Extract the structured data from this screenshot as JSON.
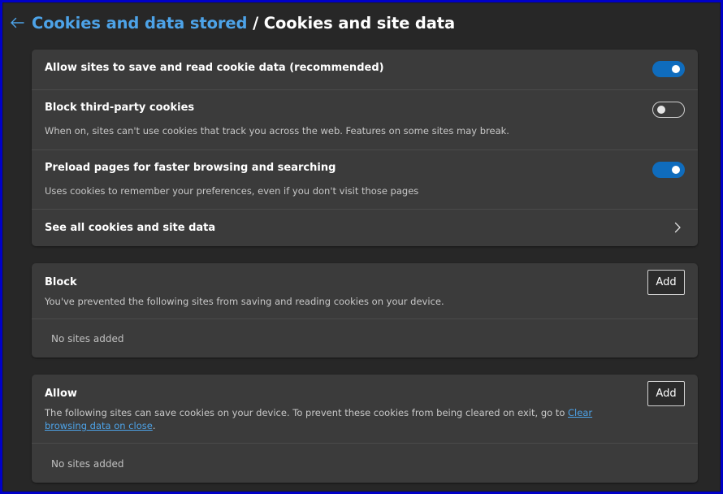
{
  "header": {
    "back_icon": "arrow-left-icon",
    "parent_crumb": "Cookies and data stored",
    "separator": " / ",
    "current": "Cookies and site data"
  },
  "settings": {
    "allow_sites": {
      "title": "Allow sites to save and read cookie data (recommended)",
      "enabled": true
    },
    "block_third_party": {
      "title": "Block third-party cookies",
      "description": "When on, sites can't use cookies that track you across the web. Features on some sites may break.",
      "enabled": false
    },
    "preload_pages": {
      "title": "Preload pages for faster browsing and searching",
      "description": "Uses cookies to remember your preferences, even if you don't visit those pages",
      "enabled": true
    },
    "see_all": {
      "title": "See all cookies and site data",
      "icon": "chevron-right-icon"
    }
  },
  "block": {
    "title": "Block",
    "description": "You've prevented the following sites from saving and reading cookies on your device.",
    "add_label": "Add",
    "empty_text": "No sites added"
  },
  "allow": {
    "title": "Allow",
    "description_before": "The following sites can save cookies on your device. To prevent these cookies from being cleared on exit, go to ",
    "link_text": "Clear browsing data on close",
    "description_after": ".",
    "add_label": "Add",
    "empty_text": "No sites added"
  },
  "colors": {
    "accent": "#0f6cbd",
    "link": "#4da3e8",
    "background": "#272727",
    "card": "#3b3b3b",
    "outer_border": "#0000c8"
  }
}
